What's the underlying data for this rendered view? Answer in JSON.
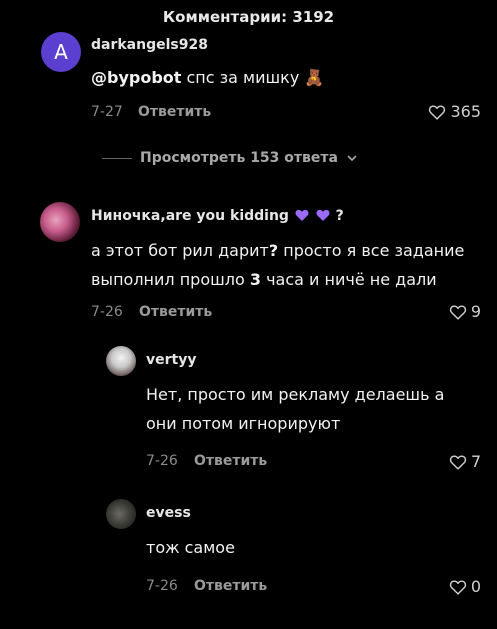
{
  "header": {
    "title": "Комментарии: 3192"
  },
  "comments": [
    {
      "avatar_letter": "A",
      "username": "darkangels928",
      "mention": "@bypobot",
      "text": " спс за мишку ",
      "emoji": "🧸",
      "date": "7-27",
      "reply_label": "Ответить",
      "likes": "365",
      "view_replies": "Просмотреть 153 ответа"
    },
    {
      "username": "Ниночка,are you kidding",
      "username_suffix": "?",
      "text_line1_a": "а этот бот рил дарит",
      "text_line1_q": "?",
      "text_line1_b": " просто я все задание",
      "text_line2_a": "выполнил прошло ",
      "text_line2_num": "3",
      "text_line2_b": " часа и ничё не дали",
      "date": "7-26",
      "reply_label": "Ответить",
      "likes": "9"
    }
  ],
  "replies": [
    {
      "username": "vertyy",
      "text_line1": "Нет, просто им рекламу делаешь а",
      "text_line2": "они потом игнорируют",
      "date": "7-26",
      "reply_label": "Ответить",
      "likes": "7"
    },
    {
      "username": "evess",
      "text_line1": "тож самое",
      "date": "7-26",
      "reply_label": "Ответить",
      "likes": "0"
    }
  ],
  "colors": {
    "accent_avatar": "#5b3fd0",
    "purple_heart": "#9b6bff"
  }
}
